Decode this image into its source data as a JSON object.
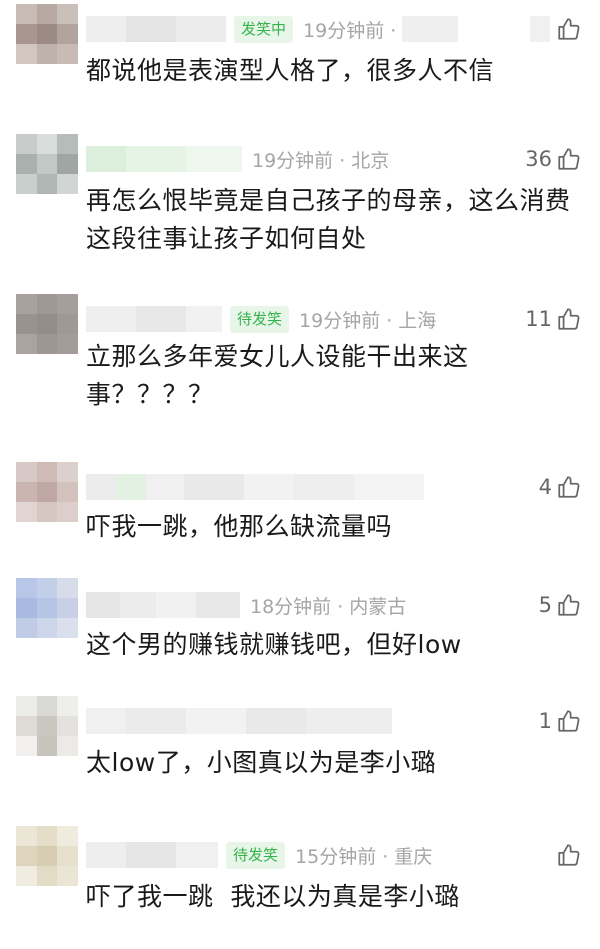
{
  "comments": [
    {
      "badge": "发笑中",
      "time": "19分钟前 ·",
      "location": "",
      "likes": "",
      "text": "都说他是表演型人格了，很多人不信"
    },
    {
      "badge": "",
      "time": "19分钟前 · 北京",
      "location": "北京",
      "likes": "36",
      "text": "再怎么恨毕竟是自己孩子的母亲，这么消费这段往事让孩子如何自处"
    },
    {
      "badge": "待发笑",
      "time": "19分钟前 · 上海",
      "location": "上海",
      "likes": "11",
      "text": "立那么多年爱女儿人设能干出来这事？？？？"
    },
    {
      "badge": "",
      "time": "",
      "location": "",
      "likes": "4",
      "text": "吓我一跳，他那么缺流量吗"
    },
    {
      "badge": "",
      "time": "18分钟前 · 内蒙古",
      "location": "内蒙古",
      "likes": "5",
      "text": "这个男的赚钱就赚钱吧，但好low"
    },
    {
      "badge": "",
      "time": "",
      "location": "",
      "likes": "1",
      "text": "太low了，小图真以为是李小璐"
    },
    {
      "badge": "待发笑",
      "time": "15分钟前 · 重庆",
      "location": "重庆",
      "likes": "",
      "text": "吓了我一跳  我还以为真是李小璐"
    }
  ],
  "icons": {
    "like": "thumbs-up-icon"
  },
  "colors": {
    "badge_text": "#35b34a",
    "badge_bg": "#e8f6ea",
    "meta": "#a5a5a5"
  }
}
